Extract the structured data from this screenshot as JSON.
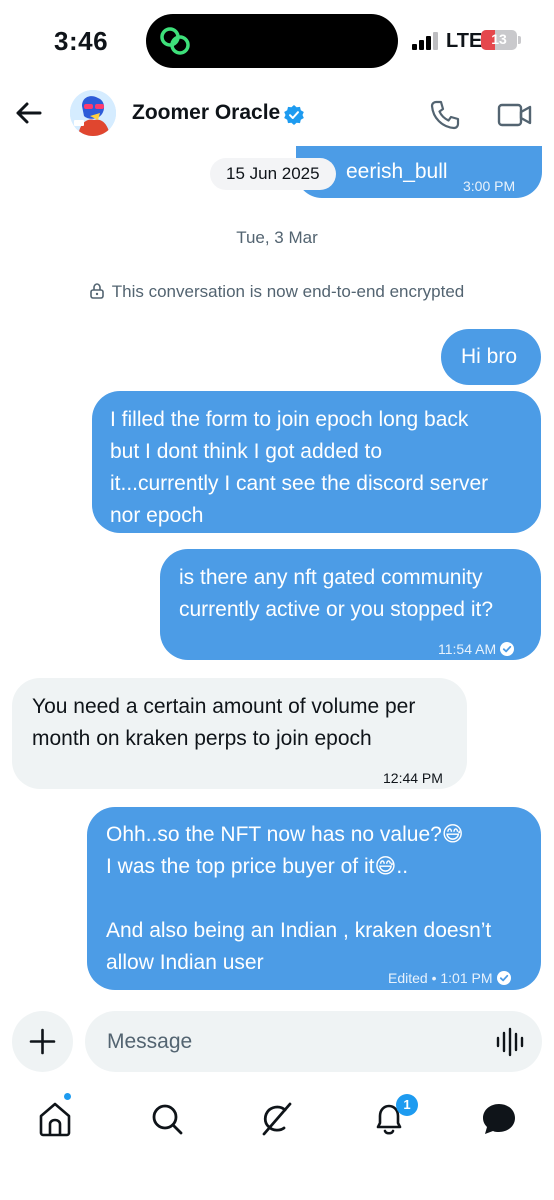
{
  "status_bar": {
    "time": "3:46",
    "network": "LTE",
    "battery_level": "13",
    "battery_color": "#e5484d",
    "island_icon": "link-rings-icon"
  },
  "header": {
    "back_icon": "arrow-left-icon",
    "contact_name": "Zoomer Oracle",
    "verified_icon": "verified-badge-icon",
    "call_icon": "phone-icon",
    "video_icon": "video-camera-icon"
  },
  "chat": {
    "first_message": {
      "text": "eerish_bull",
      "time": "3:00 PM"
    },
    "date_pill": "15 Jun 2025",
    "date_separator": "Tue, 3 Mar",
    "encryption_notice": "This conversation is now end-to-end encrypted",
    "messages": [
      {
        "direction": "out",
        "lines": [
          "Hi bro"
        ]
      },
      {
        "direction": "out",
        "lines": [
          "I filled the form to join epoch long back",
          "but I dont think I got added to",
          "it...currently I cant see the discord server",
          "nor epoch"
        ]
      },
      {
        "direction": "out",
        "lines": [
          "is there any nft gated community",
          "currently active or you stopped it?"
        ],
        "time": "11:54 AM",
        "read": true
      },
      {
        "direction": "in",
        "lines": [
          "You need a certain amount of volume per",
          "month on kraken perps to join epoch"
        ],
        "time": "12:44 PM"
      },
      {
        "direction": "out",
        "lines": [
          "Ohh..so the NFT now has no value?😅",
          "I was the top price buyer of it😅..",
          "",
          "And also being an Indian , kraken doesn’t",
          "allow Indian user"
        ],
        "time": "Edited • 1:01 PM",
        "read": true
      }
    ]
  },
  "composer": {
    "placeholder": "Message",
    "plus_icon": "plus-icon",
    "voice_icon": "voice-waveform-icon"
  },
  "tabbar": {
    "tabs": [
      "home-icon",
      "search-icon",
      "grok-icon",
      "notifications-icon",
      "messages-icon"
    ],
    "notifications_badge": "1"
  },
  "colors": {
    "outgoing_bubble": "#4c9ce6",
    "incoming_bubble": "#eff3f4",
    "accent": "#1d9bf0"
  }
}
